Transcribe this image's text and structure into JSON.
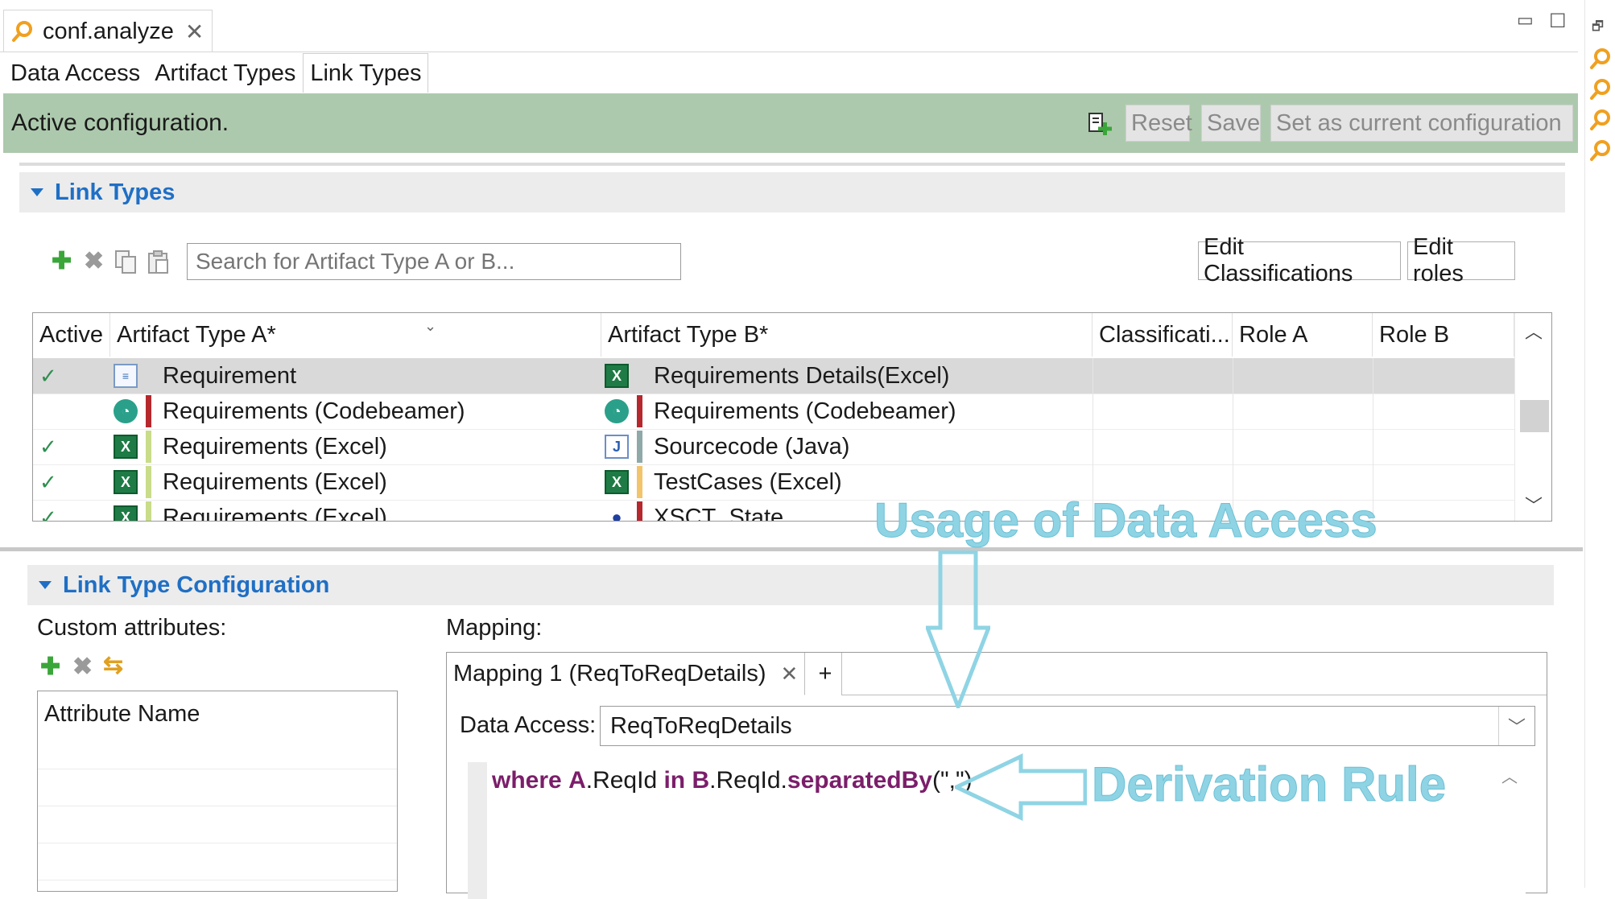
{
  "editor_tab": {
    "title": "conf.analyze",
    "close": "✕"
  },
  "window_controls": {
    "minimize": "▭",
    "maximize": "☐",
    "restore": "🗗"
  },
  "page_tabs": [
    {
      "label": "Data Access",
      "active": false
    },
    {
      "label": "Artifact Types",
      "active": false
    },
    {
      "label": "Link Types",
      "active": true
    }
  ],
  "status": {
    "text": "Active configuration.",
    "reset_label": "Reset",
    "save_label": "Save",
    "set_current_label": "Set as current configuration",
    "color": "#adc9ad"
  },
  "link_types": {
    "section_title": "Link Types",
    "search_placeholder": "Search for Artifact Type A or B...",
    "edit_classifications_label": "Edit Classifications",
    "edit_roles_label": "Edit roles",
    "columns": [
      "Active",
      "Artifact Type A*",
      "Artifact Type B*",
      "Classificati...",
      "Role A",
      "Role B"
    ],
    "rows": [
      {
        "active": "",
        "a_icon": "doc",
        "a": "Requirement",
        "a_color": "",
        "b_icon": "excel",
        "b": "Requirements Details(Excel)",
        "b_color": "",
        "selected": true
      },
      {
        "active": "",
        "a_icon": "codebeamer",
        "a": "Requirements (Codebeamer)",
        "a_color": "#b5282e",
        "b_icon": "codebeamer",
        "b": "Requirements (Codebeamer)",
        "b_color": "#b5282e",
        "selected": false
      },
      {
        "active": "",
        "a_icon": "excel",
        "a": "Requirements (Excel)",
        "a_color": "#c9dc8a",
        "b_icon": "java",
        "b": "Sourcecode (Java)",
        "b_color": "#8fa9a8",
        "selected": false
      },
      {
        "active": "",
        "a_icon": "excel",
        "a": "Requirements (Excel)",
        "a_color": "#c9dc8a",
        "b_icon": "excel",
        "b": "TestCases (Excel)",
        "b_color": "#f2c46b",
        "selected": false
      },
      {
        "active": "",
        "a_icon": "excel",
        "a": "Requirements (Excel)",
        "a_color": "#c9dc8a",
        "b_icon": "state",
        "b": "XSCT_State",
        "b_color": "#b5282e",
        "selected": false
      }
    ],
    "active_flags": [
      true,
      false,
      true,
      true,
      true
    ]
  },
  "config": {
    "section_title": "Link Type Configuration",
    "custom_attributes_label": "Custom attributes:",
    "attribute_column": "Attribute Name",
    "mapping_label": "Mapping:",
    "mapping_tab": "Mapping 1 (ReqToReqDetails)",
    "mapping_tab_close": "✕",
    "mapping_add": "+",
    "data_access_label": "Data Access:",
    "data_access_value": "ReqToReqDetails"
  },
  "code": {
    "kw1": "where",
    "a": "A",
    "t1": ".ReqId ",
    "kw2": "in",
    "b": "B",
    "t2": ".ReqId.",
    "fn": "separatedBy",
    "args": "(\",\")"
  },
  "annotations": {
    "usage": "Usage of Data Access",
    "derivation": "Derivation Rule",
    "color": "#8fd4e4"
  }
}
